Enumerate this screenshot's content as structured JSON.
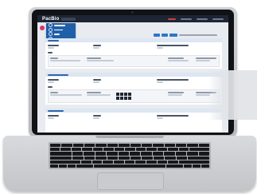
{
  "app": {
    "logo_text": "PacBio"
  },
  "colors": {
    "topbar": "#1d2534",
    "menu": "#1f5fa8",
    "accent_toggle": "#d6336c",
    "primary_button": "#2d76c7",
    "panel_header": "#dde6f2"
  },
  "icons": [
    "menu-toggle-icon",
    "menu-item-icon"
  ]
}
